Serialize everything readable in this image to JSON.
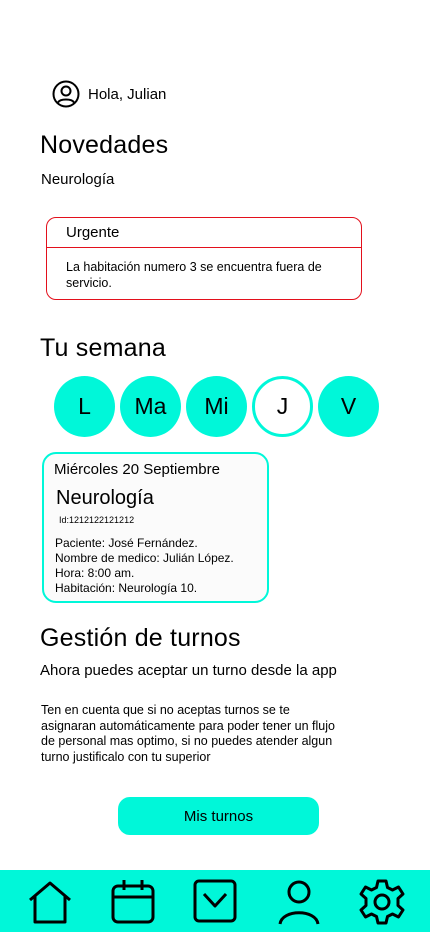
{
  "header": {
    "greeting": "Hola, Julian",
    "user_icon": "user-circle-icon"
  },
  "news": {
    "title": "Novedades",
    "department": "Neurología",
    "alert": {
      "title": "Urgente",
      "message": "La habitación numero 3 se encuentra fuera de servicio.",
      "color": "#e3101c"
    }
  },
  "week": {
    "title": "Tu semana",
    "days": [
      {
        "label": "L",
        "selected": false
      },
      {
        "label": "Ma",
        "selected": false
      },
      {
        "label": "Mi",
        "selected": false
      },
      {
        "label": "J",
        "selected": true
      },
      {
        "label": "V",
        "selected": false
      }
    ],
    "accent": "#00f7d9"
  },
  "appointment": {
    "date": "Miércoles 20 Septiembre",
    "specialty": "Neurología",
    "id": "Id:1212122121212",
    "patient": "Paciente: José Fernández.",
    "doctor": "Nombre de medico: Julián López.",
    "time": "Hora: 8:00 am.",
    "room": "Habitación: Neurología 10."
  },
  "shifts": {
    "title": "Gestión de turnos",
    "lead": "Ahora puedes aceptar un turno desde la app",
    "body": "Ten en cuenta que si no aceptas turnos se te asignaran automáticamente para poder tener un flujo de personal mas optimo, si no puedes atender algun turno justificalo con tu superior",
    "button_label": "Mis turnos"
  },
  "bottom_nav": {
    "items": [
      {
        "name": "home",
        "icon": "home-icon"
      },
      {
        "name": "calendar",
        "icon": "calendar-icon"
      },
      {
        "name": "inbox",
        "icon": "inbox-icon"
      },
      {
        "name": "profile",
        "icon": "user-icon"
      },
      {
        "name": "settings",
        "icon": "gear-icon"
      }
    ]
  }
}
